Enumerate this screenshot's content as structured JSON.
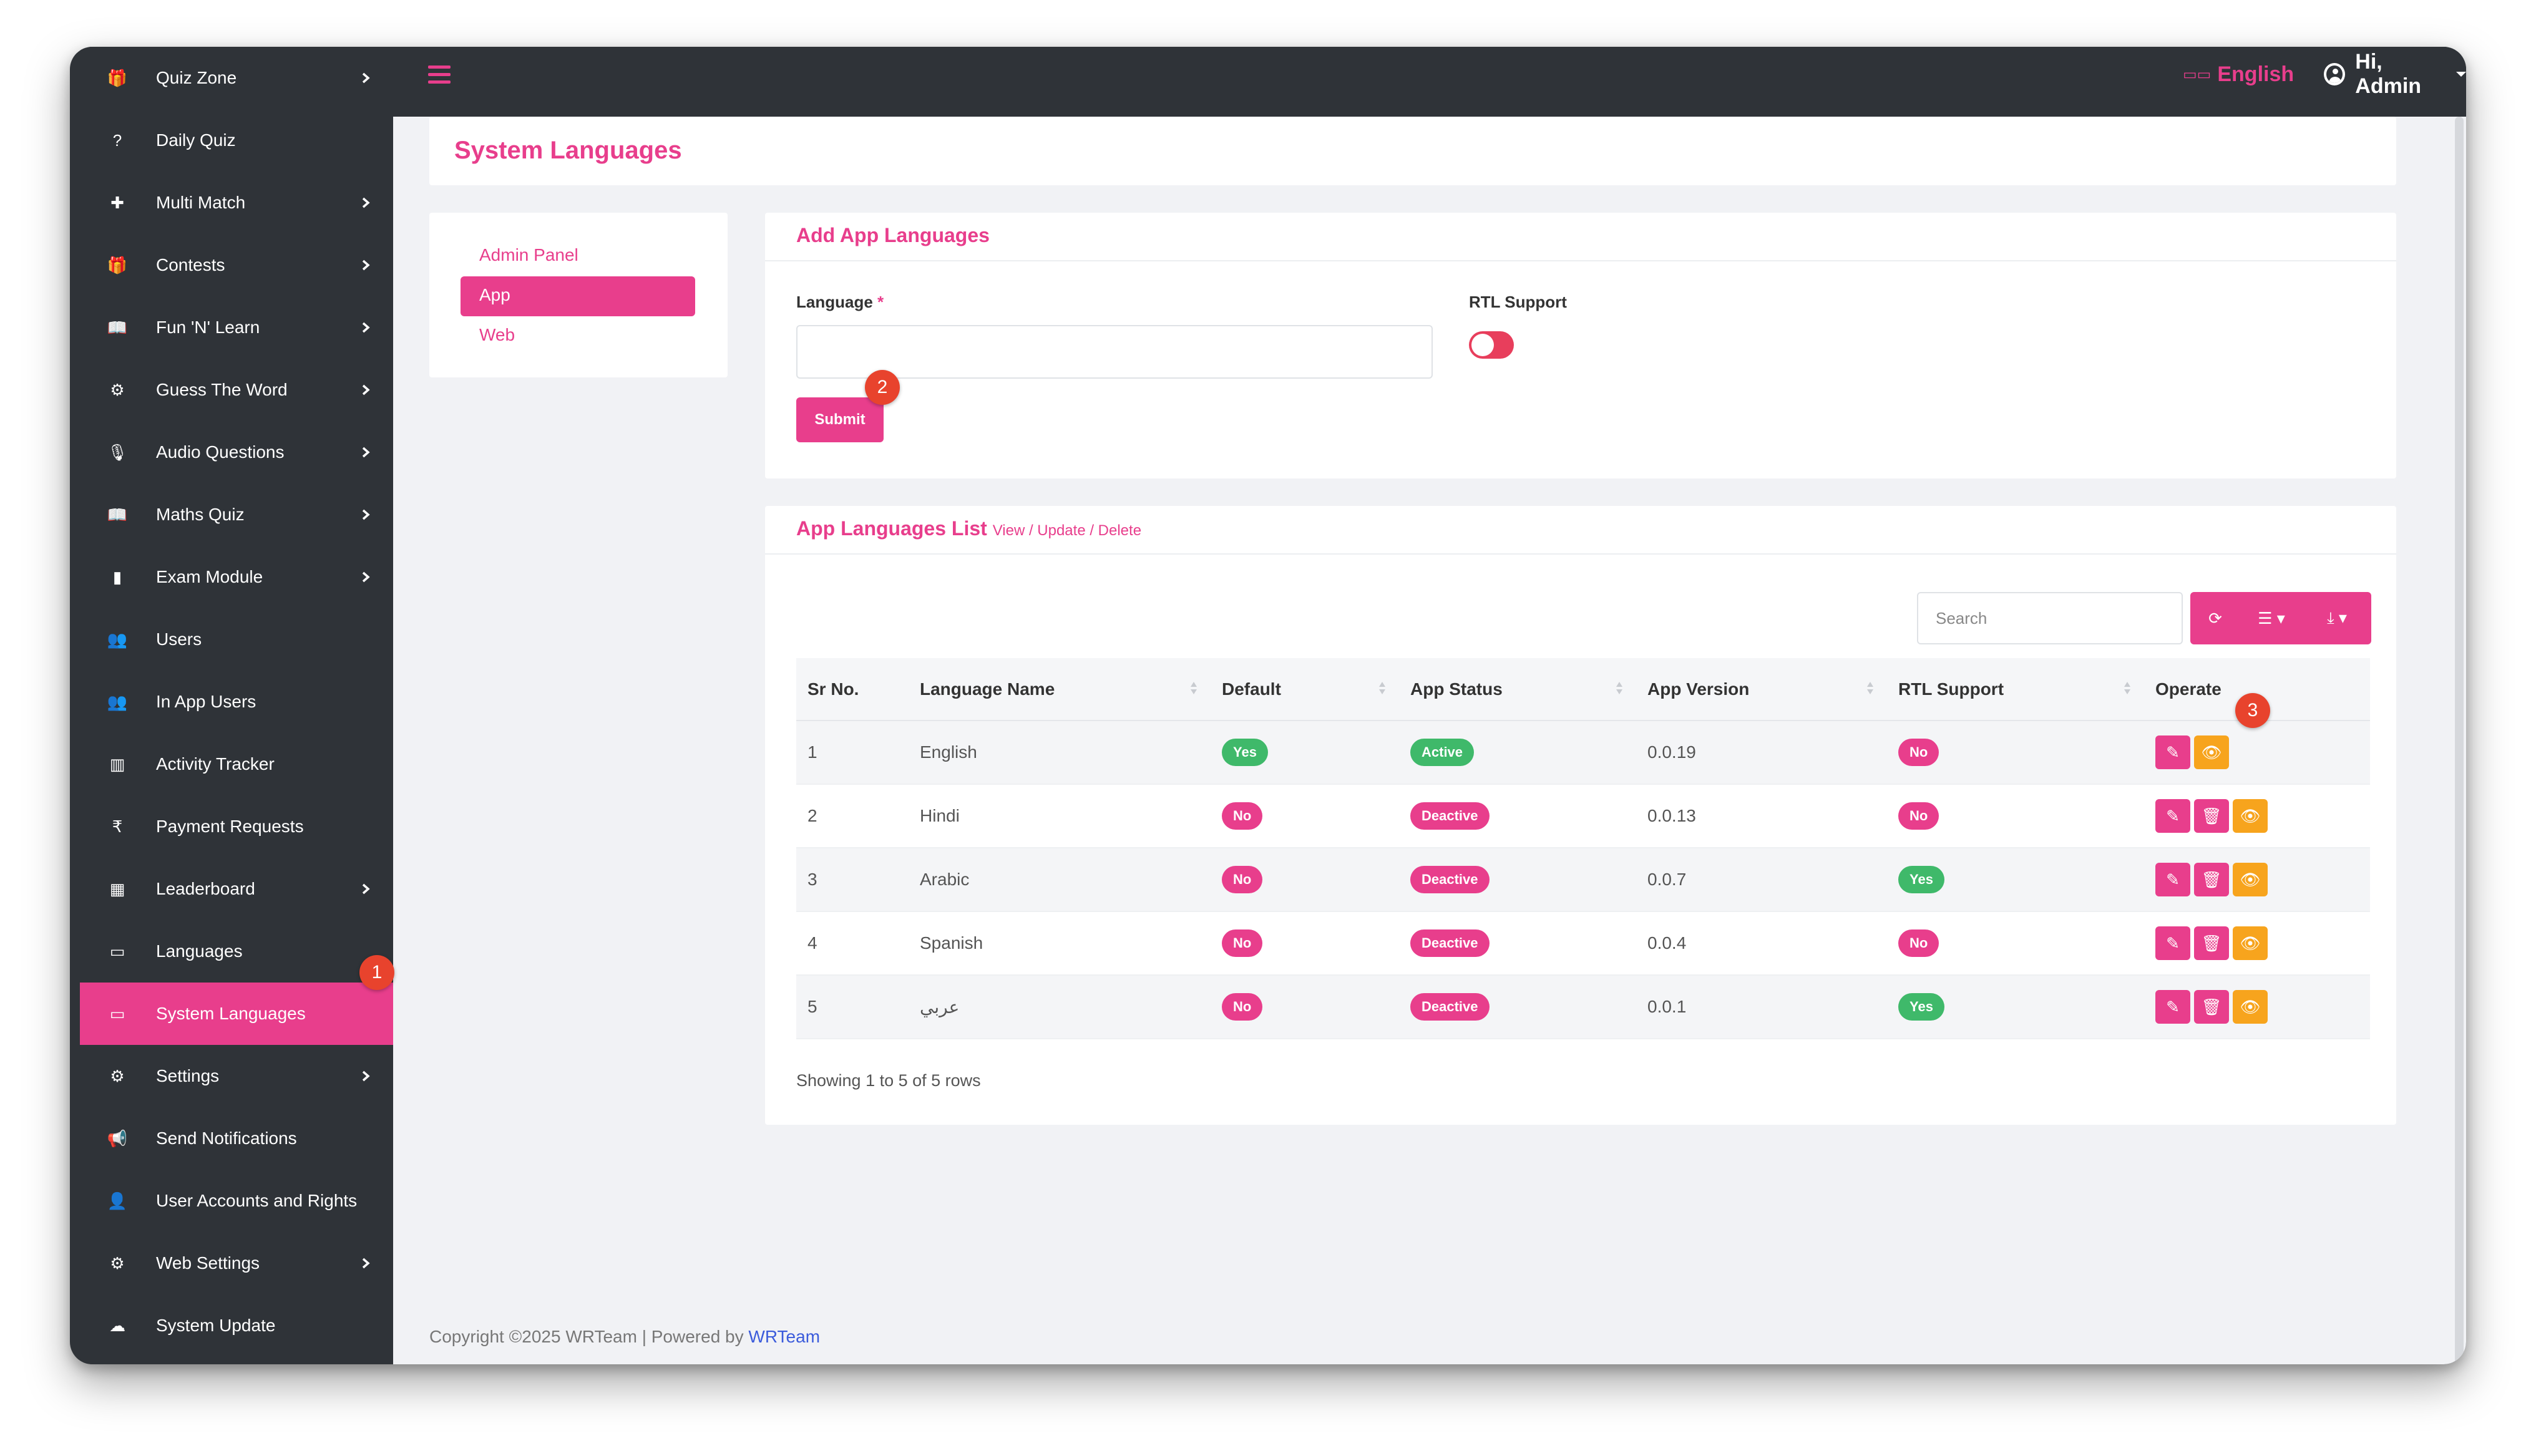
{
  "sidebar": {
    "items": [
      {
        "label": "Quiz Zone",
        "icon": "gift-icon",
        "glyph": "🎁",
        "chevron": true,
        "name": "sidebar-item-quiz-zone"
      },
      {
        "label": "Daily Quiz",
        "icon": "question-icon",
        "glyph": "?",
        "chevron": false,
        "name": "sidebar-item-daily-quiz"
      },
      {
        "label": "Multi Match",
        "icon": "puzzle-icon",
        "glyph": "✚",
        "chevron": true,
        "name": "sidebar-item-multi-match"
      },
      {
        "label": "Contests",
        "icon": "gift-icon",
        "glyph": "🎁",
        "chevron": true,
        "name": "sidebar-item-contests"
      },
      {
        "label": "Fun 'N' Learn",
        "icon": "book-icon",
        "glyph": "📖",
        "chevron": true,
        "name": "sidebar-item-fun-n-learn"
      },
      {
        "label": "Guess The Word",
        "icon": "gear-icon",
        "glyph": "⚙",
        "chevron": true,
        "name": "sidebar-item-guess-the-word"
      },
      {
        "label": "Audio Questions",
        "icon": "microphone-icon",
        "glyph": "🎙",
        "chevron": true,
        "name": "sidebar-item-audio-questions"
      },
      {
        "label": "Maths Quiz",
        "icon": "book-icon",
        "glyph": "📖",
        "chevron": true,
        "name": "sidebar-item-maths-quiz"
      },
      {
        "label": "Exam Module",
        "icon": "book-closed-icon",
        "glyph": "▮",
        "chevron": true,
        "name": "sidebar-item-exam-module"
      },
      {
        "label": "Users",
        "icon": "users-icon",
        "glyph": "👥",
        "chevron": false,
        "name": "sidebar-item-users"
      },
      {
        "label": "In App Users",
        "icon": "users-icon",
        "glyph": "👥",
        "chevron": false,
        "name": "sidebar-item-in-app-users"
      },
      {
        "label": "Activity Tracker",
        "icon": "chart-icon",
        "glyph": "▥",
        "chevron": false,
        "name": "sidebar-item-activity-tracker"
      },
      {
        "label": "Payment Requests",
        "icon": "rupee-icon",
        "glyph": "₹",
        "chevron": false,
        "name": "sidebar-item-payment-requests"
      },
      {
        "label": "Leaderboard",
        "icon": "grid-icon",
        "glyph": "▦",
        "chevron": true,
        "name": "sidebar-item-leaderboard"
      },
      {
        "label": "Languages",
        "icon": "language-icon",
        "glyph": "▭",
        "chevron": false,
        "name": "sidebar-item-languages"
      },
      {
        "label": "System Languages",
        "icon": "language-icon",
        "glyph": "▭",
        "chevron": false,
        "name": "sidebar-item-system-languages",
        "active": true
      },
      {
        "label": "Settings",
        "icon": "gear-icon",
        "glyph": "⚙",
        "chevron": true,
        "name": "sidebar-item-settings"
      },
      {
        "label": "Send Notifications",
        "icon": "megaphone-icon",
        "glyph": "📢",
        "chevron": false,
        "name": "sidebar-item-send-notifications"
      },
      {
        "label": "User Accounts and Rights",
        "icon": "user-icon",
        "glyph": "👤",
        "chevron": false,
        "name": "sidebar-item-user-accounts-and-rights"
      },
      {
        "label": "Web Settings",
        "icon": "gear-icon",
        "glyph": "⚙",
        "chevron": true,
        "name": "sidebar-item-web-settings"
      },
      {
        "label": "System Update",
        "icon": "cloud-upload-icon",
        "glyph": "☁",
        "chevron": false,
        "name": "sidebar-item-system-update"
      }
    ]
  },
  "topbar": {
    "language": "English",
    "language_icon": "language-icon",
    "greeting": "Hi, Admin",
    "accent": "#e83e8c"
  },
  "page": {
    "title": "System Languages"
  },
  "subnav": {
    "items": [
      "Admin Panel",
      "App",
      "Web"
    ],
    "active": "App"
  },
  "form": {
    "heading": "Add App Languages",
    "language_label": "Language",
    "required_mark": "*",
    "language_value": "",
    "rtl_label": "RTL Support",
    "rtl_enabled": false,
    "submit_label": "Submit"
  },
  "list": {
    "heading": "App Languages List",
    "subheading": "View / Update / Delete",
    "search_placeholder": "Search",
    "columns": [
      "Sr No.",
      "Language Name",
      "Default",
      "App Status",
      "App Version",
      "RTL Support",
      "Operate"
    ],
    "rows": [
      {
        "sr": "1",
        "name": "English",
        "default": "Yes",
        "status": "Active",
        "version": "0.0.19",
        "rtl": "No",
        "deletable": false
      },
      {
        "sr": "2",
        "name": "Hindi",
        "default": "No",
        "status": "Deactive",
        "version": "0.0.13",
        "rtl": "No",
        "deletable": true
      },
      {
        "sr": "3",
        "name": "Arabic",
        "default": "No",
        "status": "Deactive",
        "version": "0.0.7",
        "rtl": "Yes",
        "deletable": true
      },
      {
        "sr": "4",
        "name": "Spanish",
        "default": "No",
        "status": "Deactive",
        "version": "0.0.4",
        "rtl": "No",
        "deletable": true
      },
      {
        "sr": "5",
        "name": "عربي",
        "default": "No",
        "status": "Deactive",
        "version": "0.0.1",
        "rtl": "Yes",
        "deletable": true
      }
    ],
    "footer": "Showing 1 to 5 of 5 rows"
  },
  "annotations": [
    "1",
    "2",
    "3"
  ],
  "footer": {
    "copyright": "Copyright ©2025 WRTeam | Powered by ",
    "link": "WRTeam"
  },
  "colors": {
    "accent": "#e83e8c",
    "green": "#3fb96a",
    "orange": "#f7a41d",
    "sidebar": "#2f3338"
  }
}
